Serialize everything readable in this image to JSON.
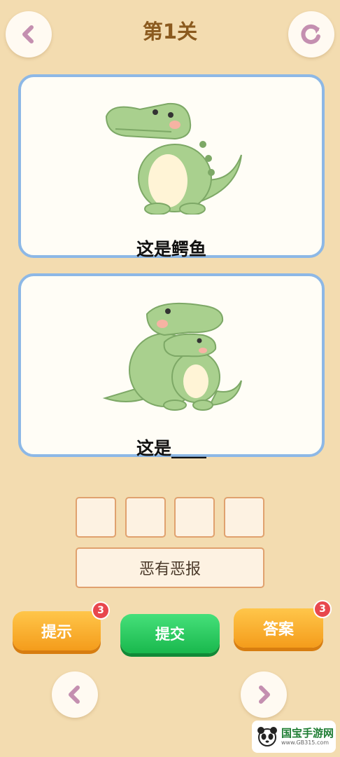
{
  "header": {
    "title": "第1关",
    "back_icon": "chevron-left-icon",
    "refresh_icon": "refresh-icon"
  },
  "cards": [
    {
      "image": "crocodile-illustration",
      "caption": "这是鳄鱼"
    },
    {
      "image": "crocodile-hug-illustration",
      "caption": "这是____"
    }
  ],
  "answer_slots": [
    "",
    "",
    "",
    ""
  ],
  "word_option": "恶有恶报",
  "actions": {
    "hint_label": "提示",
    "hint_count": "3",
    "submit_label": "提交",
    "answer_label": "答案",
    "answer_count": "3"
  },
  "nav": {
    "prev_icon": "chevron-left-icon",
    "next_icon": "chevron-right-icon"
  },
  "watermark": {
    "main": "国宝手游网",
    "sub": "www.GB315.com"
  },
  "colors": {
    "background": "#f3dcb0",
    "card_border": "#8db8e6",
    "title": "#8b5a1e",
    "arrow": "#c48fb0",
    "orange_button": "#f5a623",
    "green_button": "#22c55e",
    "badge": "#e8474d",
    "slot_border": "#e0a16e"
  }
}
